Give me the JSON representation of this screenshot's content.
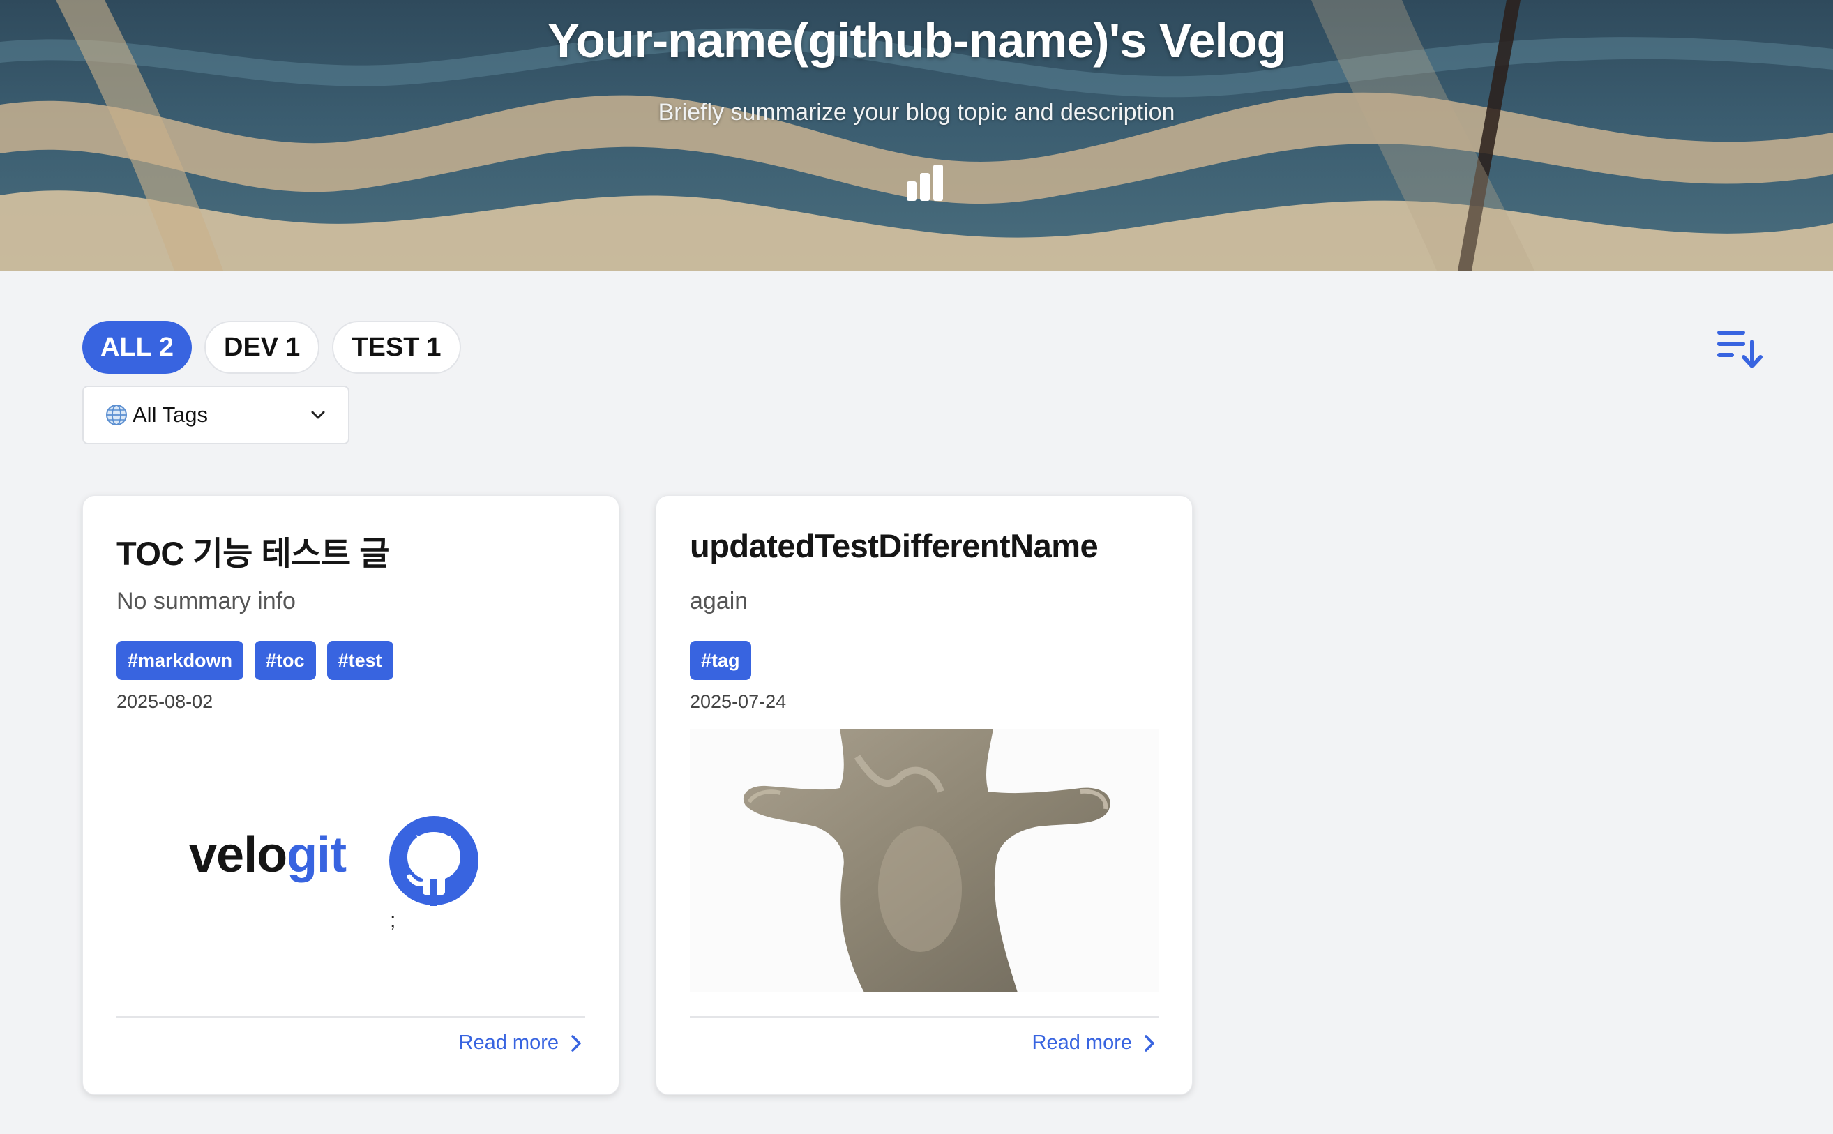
{
  "hero": {
    "title": "Your-name(github-name)'s Velog",
    "description": "Briefly summarize your blog topic and description",
    "stats_icon": "bar-chart-icon"
  },
  "categories": [
    {
      "name": "ALL",
      "count": "2",
      "active": true
    },
    {
      "name": "DEV",
      "count": "1",
      "active": false
    },
    {
      "name": "TEST",
      "count": "1",
      "active": false
    }
  ],
  "tag_filter": {
    "icon": "globe-icon",
    "selected": "All Tags",
    "chevron": "chevron-down-icon"
  },
  "sort": {
    "icon": "sort-descending-icon"
  },
  "posts": [
    {
      "title": "TOC 기능 테스트 글",
      "summary": "No summary info",
      "tags": [
        "#markdown",
        "#toc",
        "#test"
      ],
      "date": "2025-08-02",
      "thumbnail": {
        "type": "logo",
        "text_main": "velo",
        "text_accent": "git",
        "caption": ";"
      },
      "read_more": "Read more"
    },
    {
      "title": "updatedTestDifferentName",
      "summary": "again",
      "tags": [
        "#tag"
      ],
      "date": "2025-07-24",
      "thumbnail": {
        "type": "photo"
      },
      "read_more": "Read more"
    }
  ],
  "colors": {
    "accent": "#3864e0",
    "page_bg": "#f2f3f5",
    "card_bg": "#ffffff"
  }
}
